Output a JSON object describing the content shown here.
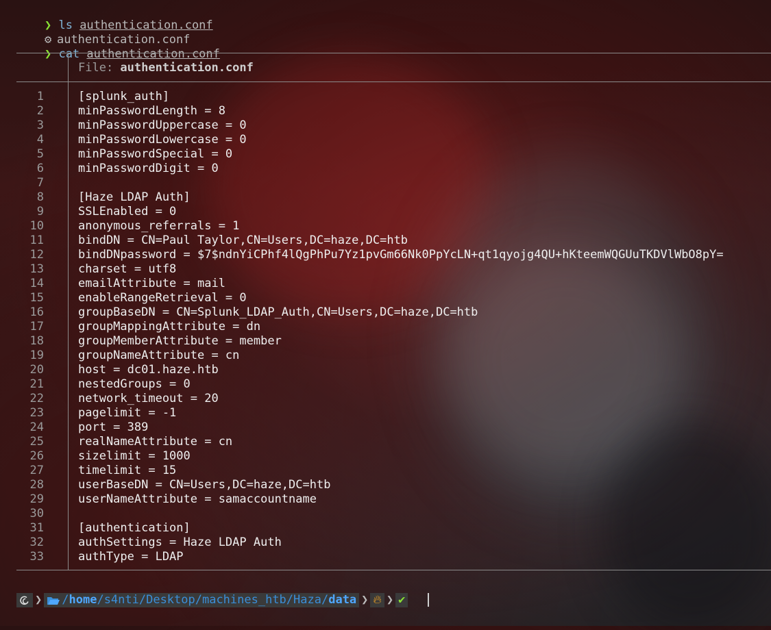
{
  "commands": [
    {
      "prompt": "❯",
      "cmd": "ls",
      "arg": "authentication.conf"
    },
    {
      "prompt": "❯",
      "cmd": "cat",
      "arg": "authentication.conf"
    }
  ],
  "ls_output": {
    "icon": "gear-icon",
    "text": "authentication.conf"
  },
  "file_header": {
    "label": "File: ",
    "name": "authentication.conf"
  },
  "lines": [
    {
      "n": "1",
      "t": "[splunk_auth]"
    },
    {
      "n": "2",
      "t": "minPasswordLength = 8"
    },
    {
      "n": "3",
      "t": "minPasswordUppercase = 0"
    },
    {
      "n": "4",
      "t": "minPasswordLowercase = 0"
    },
    {
      "n": "5",
      "t": "minPasswordSpecial = 0"
    },
    {
      "n": "6",
      "t": "minPasswordDigit = 0"
    },
    {
      "n": "7",
      "t": ""
    },
    {
      "n": "8",
      "t": "[Haze LDAP Auth]"
    },
    {
      "n": "9",
      "t": "SSLEnabled = 0"
    },
    {
      "n": "10",
      "t": "anonymous_referrals = 1"
    },
    {
      "n": "11",
      "t": "bindDN = CN=Paul Taylor,CN=Users,DC=haze,DC=htb"
    },
    {
      "n": "12",
      "t": "bindDNpassword = $7$ndnYiCPhf4lQgPhPu7Yz1pvGm66Nk0PpYcLN+qt1qyojg4QU+hKteemWQGUuTKDVlWbO8pY="
    },
    {
      "n": "13",
      "t": "charset = utf8"
    },
    {
      "n": "14",
      "t": "emailAttribute = mail"
    },
    {
      "n": "15",
      "t": "enableRangeRetrieval = 0"
    },
    {
      "n": "16",
      "t": "groupBaseDN = CN=Splunk_LDAP_Auth,CN=Users,DC=haze,DC=htb"
    },
    {
      "n": "17",
      "t": "groupMappingAttribute = dn"
    },
    {
      "n": "18",
      "t": "groupMemberAttribute = member"
    },
    {
      "n": "19",
      "t": "groupNameAttribute = cn"
    },
    {
      "n": "20",
      "t": "host = dc01.haze.htb"
    },
    {
      "n": "21",
      "t": "nestedGroups = 0"
    },
    {
      "n": "22",
      "t": "network_timeout = 20"
    },
    {
      "n": "23",
      "t": "pagelimit = -1"
    },
    {
      "n": "24",
      "t": "port = 389"
    },
    {
      "n": "25",
      "t": "realNameAttribute = cn"
    },
    {
      "n": "26",
      "t": "sizelimit = 1000"
    },
    {
      "n": "27",
      "t": "timelimit = 15"
    },
    {
      "n": "28",
      "t": "userBaseDN = CN=Users,DC=haze,DC=htb"
    },
    {
      "n": "29",
      "t": "userNameAttribute = samaccountname"
    },
    {
      "n": "30",
      "t": ""
    },
    {
      "n": "31",
      "t": "[authentication]"
    },
    {
      "n": "32",
      "t": "authSettings = Haze LDAP Auth"
    },
    {
      "n": "33",
      "t": "authType = LDAP"
    }
  ],
  "statusbar": {
    "os_icon": "debian-swirl-icon",
    "folder_icon": "folder-open-icon",
    "path_prefix": "/",
    "path_home": "home",
    "path_middle": "/s4nti/Desktop/machines_htb/Haza/",
    "path_current": "data",
    "fire_icon": "fire-icon",
    "check_icon": "checkmark-icon"
  },
  "colors": {
    "prompt": "#8ae234",
    "command": "#7fb3d5",
    "path": "#3b8ed8",
    "rule": "#8b8b8b"
  }
}
